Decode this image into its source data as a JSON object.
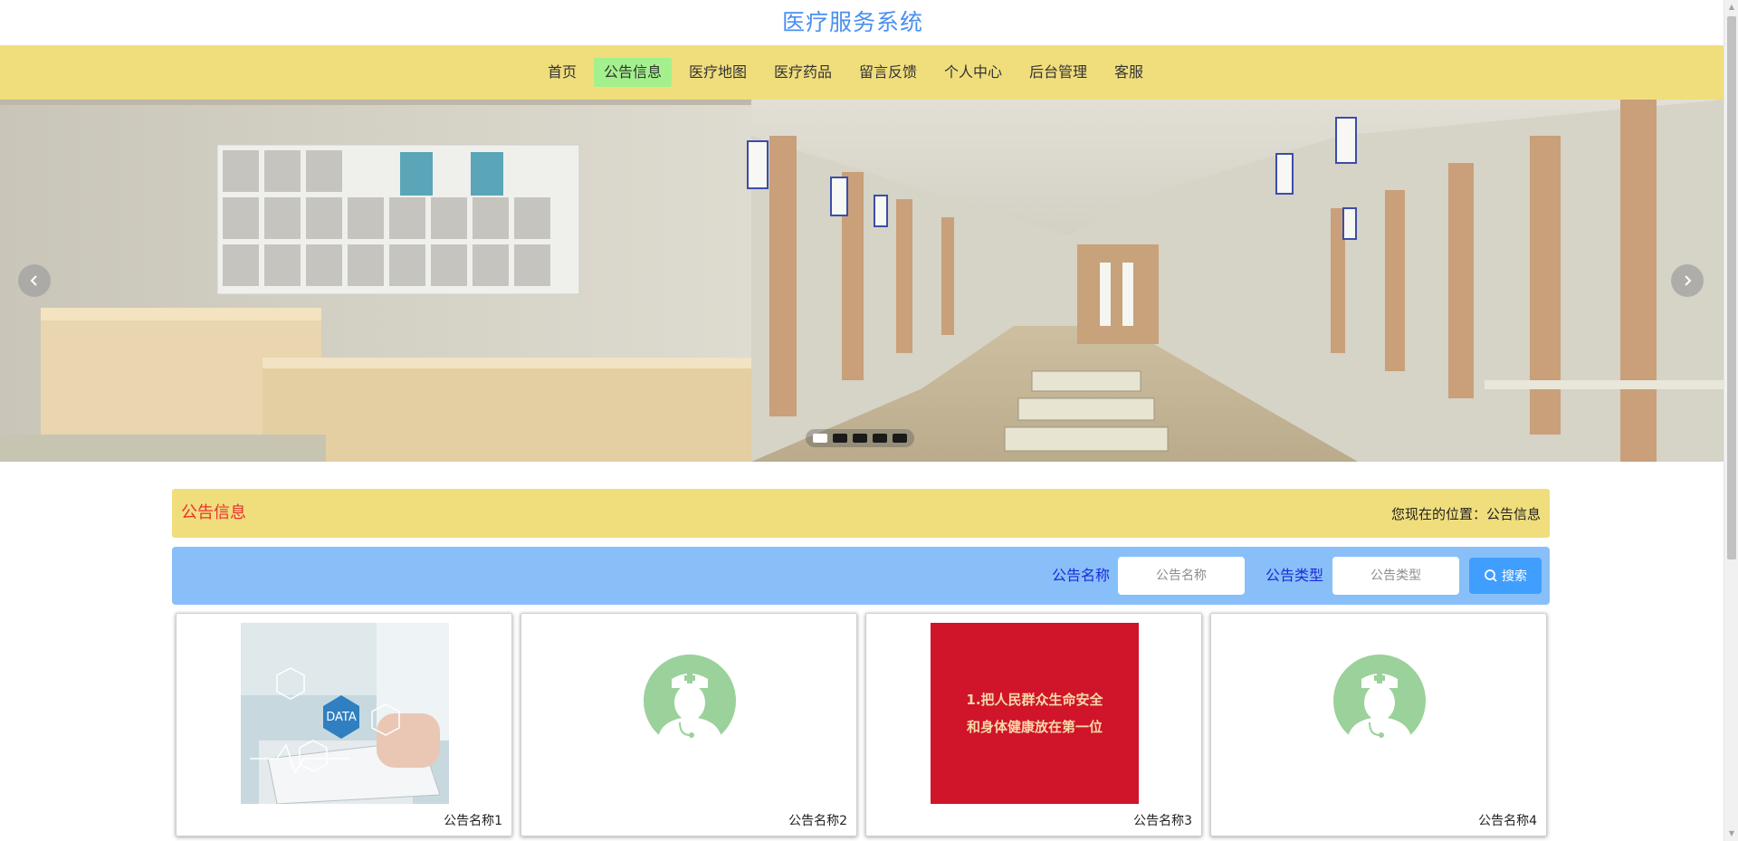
{
  "header": {
    "site_title": "医疗服务系统"
  },
  "nav": {
    "items": [
      {
        "label": "首页",
        "active": false
      },
      {
        "label": "公告信息",
        "active": true
      },
      {
        "label": "医疗地图",
        "active": false
      },
      {
        "label": "医疗药品",
        "active": false
      },
      {
        "label": "留言反馈",
        "active": false
      },
      {
        "label": "个人中心",
        "active": false
      },
      {
        "label": "后台管理",
        "active": false
      },
      {
        "label": "客服",
        "active": false
      }
    ]
  },
  "carousel": {
    "prev_icon": "chevron-left-icon",
    "next_icon": "chevron-right-icon",
    "slide_count": 5,
    "active_index": 0
  },
  "section": {
    "title": "公告信息",
    "breadcrumb": "您现在的位置：公告信息"
  },
  "search": {
    "name_label": "公告名称",
    "name_placeholder": "公告名称",
    "type_label": "公告类型",
    "type_placeholder": "公告类型",
    "button_label": "搜索",
    "button_icon": "search-icon"
  },
  "cards": [
    {
      "name": "公告名称1",
      "image": "data-medical-photo"
    },
    {
      "name": "公告名称2",
      "image": "doctor-avatar-icon"
    },
    {
      "name": "公告名称3",
      "image": "red-slogan-poster",
      "poster_lines": [
        "1.把人民群众生命安全",
        "和身体健康放在第一位"
      ]
    },
    {
      "name": "公告名称4",
      "image": "doctor-avatar-icon"
    }
  ],
  "colors": {
    "title_blue": "#4a8ff0",
    "nav_bg": "#f0de7d",
    "nav_active": "#a3f08d",
    "section_title_red": "#e8312f",
    "search_bar_bg": "#88bff9",
    "search_label": "#1c2bd8",
    "search_button": "#409efe",
    "avatar_green": "#9bd19a",
    "poster_red": "#d0142a"
  }
}
